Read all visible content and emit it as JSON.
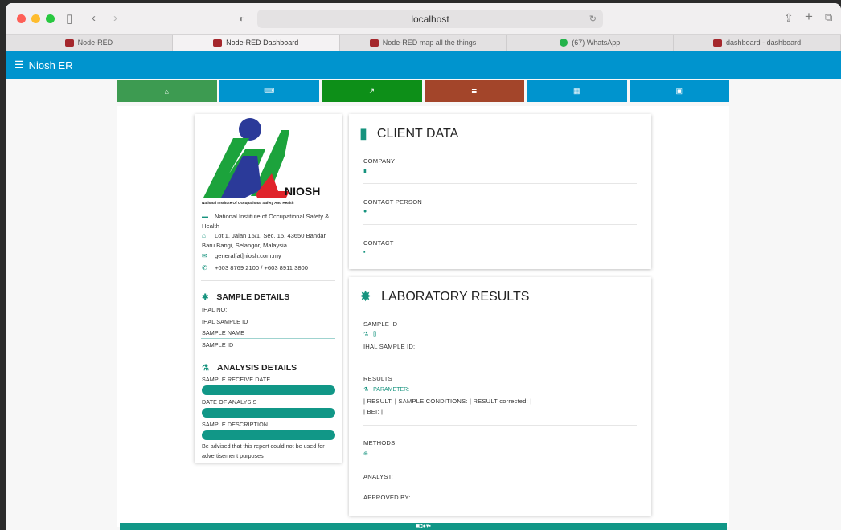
{
  "browser": {
    "url": "localhost",
    "tabs": [
      {
        "label": "Node-RED",
        "icon": "node-red-icon"
      },
      {
        "label": "Node-RED Dashboard",
        "icon": "node-red-icon",
        "active": true
      },
      {
        "label": "Node-RED map all the things",
        "icon": "node-red-icon"
      },
      {
        "label": "(67) WhatsApp",
        "icon": "whatsapp-icon"
      },
      {
        "label": "dashboard - dashboard",
        "icon": "node-red-icon"
      }
    ]
  },
  "app": {
    "title": "Niosh ER",
    "nav": [
      {
        "icon": "home-icon",
        "glyph": "⌂",
        "color": "#3d9b51"
      },
      {
        "icon": "keyboard-icon",
        "glyph": "⌨",
        "color": "#0094ce"
      },
      {
        "icon": "line-chart-icon",
        "glyph": "📈",
        "color": "#0d8f18"
      },
      {
        "icon": "database-icon",
        "glyph": "≣",
        "color": "#a3452a"
      },
      {
        "icon": "table-icon",
        "glyph": "▦",
        "color": "#0094ce"
      },
      {
        "icon": "file-icon",
        "glyph": "▣",
        "color": "#0094ce"
      }
    ]
  },
  "left_card": {
    "logo_text": "NIOSH",
    "logo_sub": "National Institute Of Occupational Safety And Health",
    "org_name": "National Institute of Occupational Safety & Health",
    "address": "Lot 1, Jalan 15/1, Sec. 15, 43650 Bandar Baru Bangi, Selangor, Malaysia",
    "email": "general[at]niosh.com.my",
    "phone": "+603 8769 2100 / +603 8911 3800",
    "sample_title": "SAMPLE DETAILS",
    "ihal_no": "IHAL NO:",
    "ihal_sample_id": "IHAL SAMPLE ID",
    "sample_name": "SAMPLE NAME",
    "sample_id": "SAMPLE ID",
    "analysis_title": "ANALYSIS DETAILS",
    "receive_date": "SAMPLE RECEIVE DATE",
    "date_analysis": "DATE OF ANALYSIS",
    "description": "SAMPLE DESCRIPTION",
    "note": "Be advised that this report could not be used for advertisement purposes"
  },
  "client": {
    "title": "CLIENT DATA",
    "company": "COMPANY",
    "contact_person": "CONTACT PERSON",
    "contact": "CONTACT"
  },
  "lab": {
    "title": "LABORATORY RESULTS",
    "sample_id": "SAMPLE ID",
    "sample_id_val": "[]",
    "ihal_sample_id": "IHAL SAMPLE ID:",
    "results": "RESULTS",
    "parameter": "PARAMETER:",
    "result_line1": "| RESULT: | SAMPLE CONDITIONS: | RESULT corrected: |",
    "result_line2": "| BEI: |",
    "methods": "METHODS",
    "analyst": "ANALYST:",
    "approved": "APPROVED BY:"
  },
  "colors": {
    "accent": "#16937e",
    "appbar": "#0094ce",
    "footer": "#119787"
  }
}
